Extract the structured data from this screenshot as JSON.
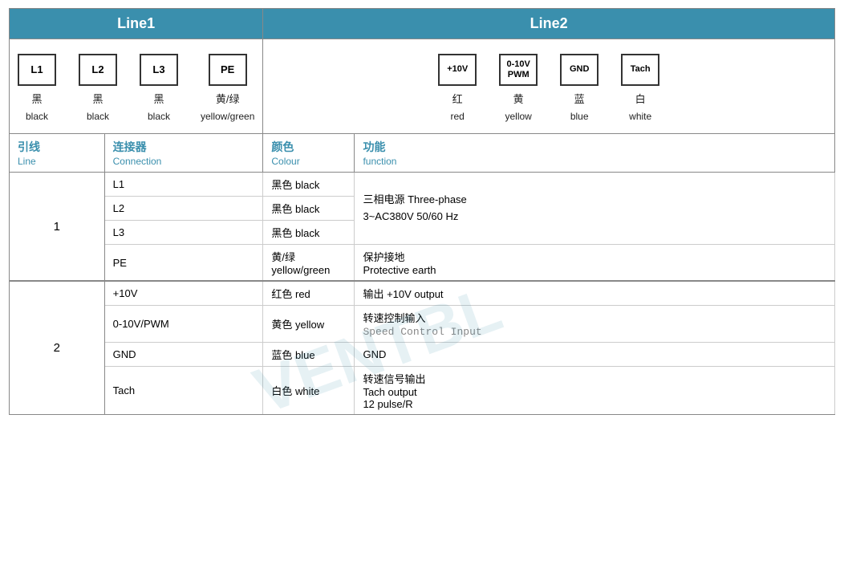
{
  "header": {
    "line1_label": "Line1",
    "line2_label": "Line2"
  },
  "line1_connectors": [
    {
      "id": "L1",
      "cn": "黑",
      "en": "black"
    },
    {
      "id": "L2",
      "cn": "黑",
      "en": "black"
    },
    {
      "id": "L3",
      "cn": "黑",
      "en": "black"
    },
    {
      "id": "PE",
      "cn": "黄/绿",
      "en": "yellow/green"
    }
  ],
  "line2_connectors": [
    {
      "id": "+10V",
      "cn": "红",
      "en": "red"
    },
    {
      "id": "0-10V\nPWM",
      "cn": "黄",
      "en": "yellow"
    },
    {
      "id": "GND",
      "cn": "蓝",
      "en": "blue"
    },
    {
      "id": "Tach",
      "cn": "白",
      "en": "white"
    }
  ],
  "table_headers": {
    "line_cn": "引线",
    "line_en": "Line",
    "conn_cn": "连接器",
    "conn_en": "Connection",
    "color_cn": "颜色",
    "color_en": "Colour",
    "func_cn": "功能",
    "func_en": "function"
  },
  "table_rows": [
    {
      "line": "1",
      "line_rowspan": 4,
      "subrows": [
        {
          "conn": "L1",
          "color": "黑色 black",
          "func": "三相电源 Three-phase\n3~AC380V 50/60 Hz",
          "func_rowspan": 3
        },
        {
          "conn": "L2",
          "color": "黑色 black",
          "func": null
        },
        {
          "conn": "L3",
          "color": "黑色 black",
          "func": null
        },
        {
          "conn": "PE",
          "color": "黄/绿\nyellow/green",
          "func": "保护接地\nProtective earth"
        }
      ]
    },
    {
      "line": "2",
      "line_rowspan": 4,
      "subrows": [
        {
          "conn": "+10V",
          "color": "红色 red",
          "func": "输出 +10V output"
        },
        {
          "conn": "0-10V/PWM",
          "color": "黄色 yellow",
          "func": "转速控制输入\nSpeed Control Input"
        },
        {
          "conn": "GND",
          "color": "蓝色 blue",
          "func": "GND"
        },
        {
          "conn": "Tach",
          "color": "白色 white",
          "func": "转速信号输出\nTach output\n12 pulse/R"
        }
      ]
    }
  ]
}
